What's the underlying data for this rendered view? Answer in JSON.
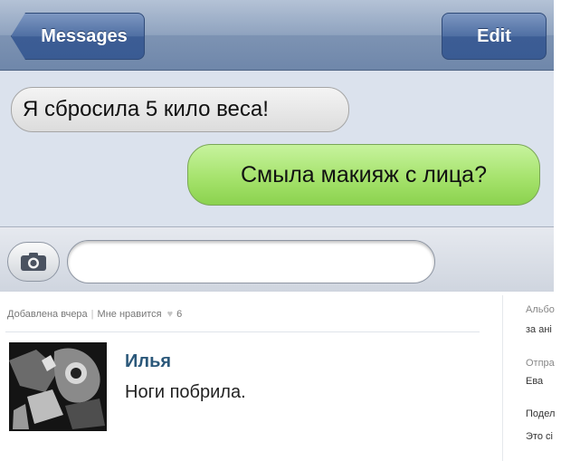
{
  "chat": {
    "back_label": "Messages",
    "edit_label": "Edit",
    "incoming_message": "Я сбросила 5 кило веса!",
    "outgoing_message": "Смыла макияж с лица?"
  },
  "colors": {
    "navbar": "#8fa3bf",
    "nav_button": "#4f6fa3",
    "incoming_bubble": "#e6e6e6",
    "outgoing_bubble": "#a6e36d",
    "vk_name": "#2b587a"
  },
  "icons": {
    "camera": "camera-icon",
    "like": "heart-icon"
  },
  "post_meta": {
    "added": "Добавлена вчера",
    "separator": "|",
    "like_label": "Мне нравится",
    "like_count": "6"
  },
  "comment": {
    "author": "Илья",
    "text": "Ноги побрила."
  },
  "right_column": {
    "album_line1": "Альбо",
    "album_line2": "за ані",
    "sent_label": "Отпра",
    "sent_by": "Ева",
    "share_label": "Подел",
    "this_label": "Это сі"
  }
}
